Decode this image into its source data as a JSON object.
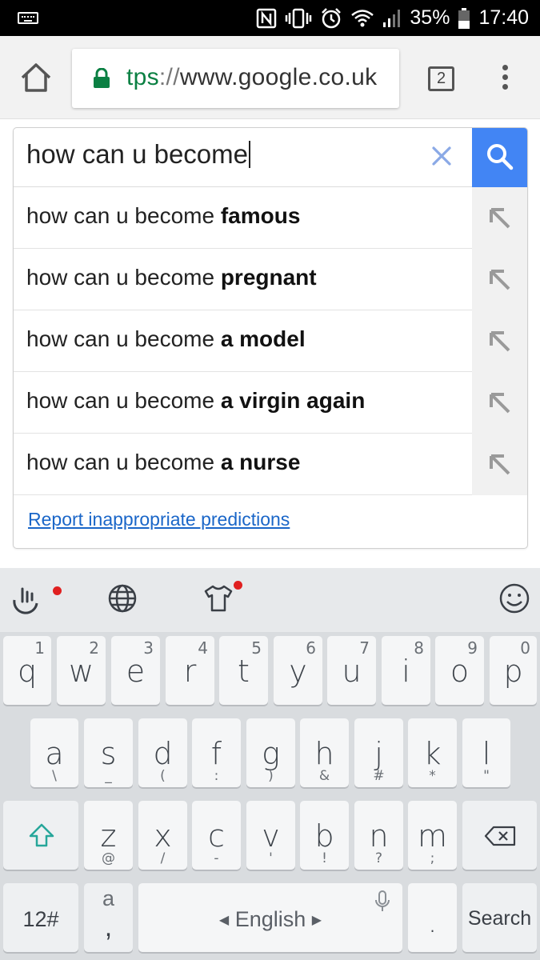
{
  "status_bar": {
    "battery": "35%",
    "time": "17:40"
  },
  "toolbar": {
    "url_scheme": "tps",
    "url_separator": "://",
    "url_host": "www.google.co.uk",
    "tab_count": "2"
  },
  "search": {
    "query": "how can u become",
    "suggestions": [
      {
        "prefix": "how can u become ",
        "bold": "famous"
      },
      {
        "prefix": "how can u become ",
        "bold": "pregnant"
      },
      {
        "prefix": "how can u become ",
        "bold": "a model"
      },
      {
        "prefix": "how can u become ",
        "bold": "a virgin again"
      },
      {
        "prefix": "how can u become ",
        "bold": "a nurse"
      }
    ],
    "report_link": "Report inappropriate predictions"
  },
  "keyboard": {
    "row1": [
      {
        "key": "q",
        "sup": "1"
      },
      {
        "key": "w",
        "sup": "2"
      },
      {
        "key": "e",
        "sup": "3"
      },
      {
        "key": "r",
        "sup": "4"
      },
      {
        "key": "t",
        "sup": "5"
      },
      {
        "key": "y",
        "sup": "6"
      },
      {
        "key": "u",
        "sup": "7"
      },
      {
        "key": "i",
        "sup": "8"
      },
      {
        "key": "o",
        "sup": "9"
      },
      {
        "key": "p",
        "sup": "0"
      }
    ],
    "row2": [
      {
        "key": "a",
        "sub": "\\"
      },
      {
        "key": "s",
        "sub": "_"
      },
      {
        "key": "d",
        "sub": "("
      },
      {
        "key": "f",
        "sub": ":"
      },
      {
        "key": "g",
        "sub": ")"
      },
      {
        "key": "h",
        "sub": "&"
      },
      {
        "key": "j",
        "sub": "#"
      },
      {
        "key": "k",
        "sub": "*"
      },
      {
        "key": "l",
        "sub": "\""
      }
    ],
    "row3": [
      {
        "key": "z",
        "sub": "@"
      },
      {
        "key": "x",
        "sub": "/"
      },
      {
        "key": "c",
        "sub": "-"
      },
      {
        "key": "v",
        "sub": "'"
      },
      {
        "key": "b",
        "sub": "!"
      },
      {
        "key": "n",
        "sub": "?"
      },
      {
        "key": "m",
        "sub": ";"
      }
    ],
    "numbers_key": "12#",
    "punct_key_top": "a",
    "punct_key_bottom": ",",
    "space_label": "English",
    "period_key": ".",
    "action_key": "Search",
    "accent_color": "#26a69a"
  },
  "colors": {
    "search_button": "#4285f4",
    "link": "#1a66c8",
    "secure_green": "#0b8043"
  }
}
